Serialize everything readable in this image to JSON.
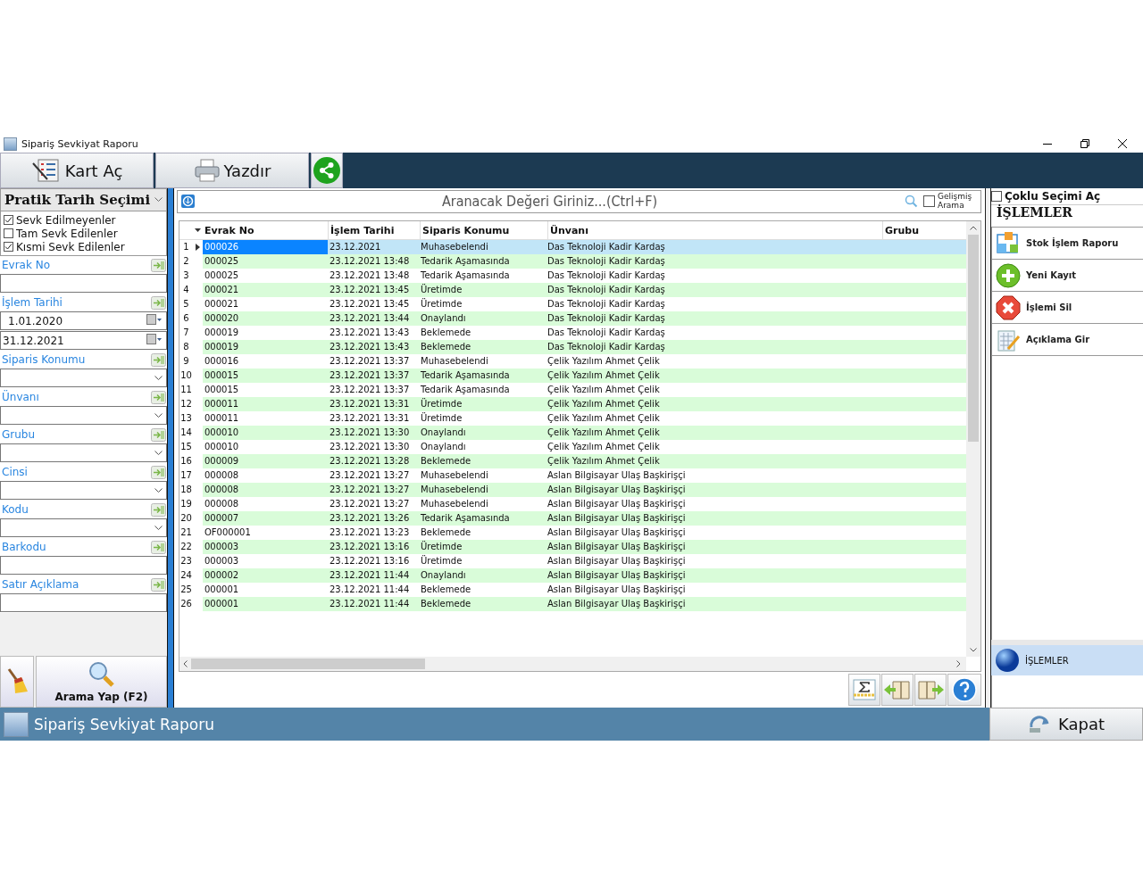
{
  "window": {
    "title": "Sipariş Sevkiyat Raporu"
  },
  "toolbar": [
    {
      "kind": "card",
      "label": "Kart Aç"
    },
    {
      "kind": "print",
      "label": "Yazdır"
    },
    {
      "kind": "share"
    }
  ],
  "filters": {
    "date_preset": "Pratik Tarih Seçimi",
    "options": [
      {
        "label": "Sevk Edilmeyenler",
        "checked": true
      },
      {
        "label": "Tam Sevk Edilenler",
        "checked": false
      },
      {
        "label": "Kısmi Sevk Edilenler",
        "checked": true
      }
    ],
    "fields": [
      {
        "label": "Evrak No",
        "kind": "text"
      },
      {
        "label": "İşlem Tarihi",
        "kind": "dates",
        "values": [
          "1.01.2020",
          "31.12.2021"
        ]
      },
      {
        "label": "Siparis Konumu",
        "kind": "combo"
      },
      {
        "label": "Ünvanı",
        "kind": "combo"
      },
      {
        "label": "Grubu",
        "kind": "combo"
      },
      {
        "label": "Cinsi",
        "kind": "combo"
      },
      {
        "label": "Kodu",
        "kind": "combo"
      },
      {
        "label": "Barkodu",
        "kind": "text"
      },
      {
        "label": "Satır Açıklama",
        "kind": "text"
      }
    ],
    "search_button": "Arama Yap (F2)"
  },
  "search": {
    "placeholder": "Aranacak Değeri Giriniz...(Ctrl+F)",
    "advanced": {
      "label": "Gelişmiş Arama",
      "checked": false
    }
  },
  "table": {
    "columns": [
      "Evrak No",
      "İşlem Tarihi",
      "Siparis Konumu",
      "Ünvanı",
      "Grubu"
    ],
    "rows": [
      {
        "n": "1",
        "cells": [
          "000026",
          "23.12.2021",
          "Muhasebelendi",
          "Das Teknoloji Kadir Kardaş"
        ],
        "selected": true
      },
      {
        "n": "2",
        "cells": [
          "000025",
          "23.12.2021 13:48",
          "Tedarik Aşamasında",
          "Das Teknoloji Kadir Kardaş"
        ],
        "selected": false
      },
      {
        "n": "3",
        "cells": [
          "000025",
          "23.12.2021 13:48",
          "Tedarik Aşamasında",
          "Das Teknoloji Kadir Kardaş"
        ],
        "selected": false
      },
      {
        "n": "4",
        "cells": [
          "000021",
          "23.12.2021 13:45",
          "Üretimde",
          "Das Teknoloji Kadir Kardaş"
        ],
        "selected": false
      },
      {
        "n": "5",
        "cells": [
          "000021",
          "23.12.2021 13:45",
          "Üretimde",
          "Das Teknoloji Kadir Kardaş"
        ],
        "selected": false
      },
      {
        "n": "6",
        "cells": [
          "000020",
          "23.12.2021 13:44",
          "Onaylandı",
          "Das Teknoloji Kadir Kardaş"
        ],
        "selected": false
      },
      {
        "n": "7",
        "cells": [
          "000019",
          "23.12.2021 13:43",
          "Beklemede",
          "Das Teknoloji Kadir Kardaş"
        ],
        "selected": false
      },
      {
        "n": "8",
        "cells": [
          "000019",
          "23.12.2021 13:43",
          "Beklemede",
          "Das Teknoloji Kadir Kardaş"
        ],
        "selected": false
      },
      {
        "n": "9",
        "cells": [
          "000016",
          "23.12.2021 13:37",
          "Muhasebelendi",
          "Çelik Yazılım Ahmet Çelik"
        ],
        "selected": false
      },
      {
        "n": "10",
        "cells": [
          "000015",
          "23.12.2021 13:37",
          "Tedarik Aşamasında",
          "Çelik Yazılım Ahmet Çelik"
        ],
        "selected": false
      },
      {
        "n": "11",
        "cells": [
          "000015",
          "23.12.2021 13:37",
          "Tedarik Aşamasında",
          "Çelik Yazılım Ahmet Çelik"
        ],
        "selected": false
      },
      {
        "n": "12",
        "cells": [
          "000011",
          "23.12.2021 13:31",
          "Üretimde",
          "Çelik Yazılım Ahmet Çelik"
        ],
        "selected": false
      },
      {
        "n": "13",
        "cells": [
          "000011",
          "23.12.2021 13:31",
          "Üretimde",
          "Çelik Yazılım Ahmet Çelik"
        ],
        "selected": false
      },
      {
        "n": "14",
        "cells": [
          "000010",
          "23.12.2021 13:30",
          "Onaylandı",
          "Çelik Yazılım Ahmet Çelik"
        ],
        "selected": false
      },
      {
        "n": "15",
        "cells": [
          "000010",
          "23.12.2021 13:30",
          "Onaylandı",
          "Çelik Yazılım Ahmet Çelik"
        ],
        "selected": false
      },
      {
        "n": "16",
        "cells": [
          "000009",
          "23.12.2021 13:28",
          "Beklemede",
          "Çelik Yazılım Ahmet Çelik"
        ],
        "selected": false
      },
      {
        "n": "17",
        "cells": [
          "000008",
          "23.12.2021 13:27",
          "Muhasebelendi",
          "Aslan Bilgisayar Ulaş Başkirişçi"
        ],
        "selected": false
      },
      {
        "n": "18",
        "cells": [
          "000008",
          "23.12.2021 13:27",
          "Muhasebelendi",
          "Aslan Bilgisayar Ulaş Başkirişçi"
        ],
        "selected": false
      },
      {
        "n": "19",
        "cells": [
          "000008",
          "23.12.2021 13:27",
          "Muhasebelendi",
          "Aslan Bilgisayar Ulaş Başkirişçi"
        ],
        "selected": false
      },
      {
        "n": "20",
        "cells": [
          "000007",
          "23.12.2021 13:26",
          "Tedarik Aşamasında",
          "Aslan Bilgisayar Ulaş Başkirişçi"
        ],
        "selected": false
      },
      {
        "n": "21",
        "cells": [
          "OF000001",
          "23.12.2021 13:23",
          "Beklemede",
          "Aslan Bilgisayar Ulaş Başkirişçi"
        ],
        "selected": false
      },
      {
        "n": "22",
        "cells": [
          "000003",
          "23.12.2021 13:16",
          "Üretimde",
          "Aslan Bilgisayar Ulaş Başkirişçi"
        ],
        "selected": false
      },
      {
        "n": "23",
        "cells": [
          "000003",
          "23.12.2021 13:16",
          "Üretimde",
          "Aslan Bilgisayar Ulaş Başkirişçi"
        ],
        "selected": false
      },
      {
        "n": "24",
        "cells": [
          "000002",
          "23.12.2021 11:44",
          "Onaylandı",
          "Aslan Bilgisayar Ulaş Başkirişçi"
        ],
        "selected": false
      },
      {
        "n": "25",
        "cells": [
          "000001",
          "23.12.2021 11:44",
          "Beklemede",
          "Aslan Bilgisayar Ulaş Başkirişçi"
        ],
        "selected": false
      },
      {
        "n": "26",
        "cells": [
          "000001",
          "23.12.2021 11:44",
          "Beklemede",
          "Aslan Bilgisayar Ulaş Başkirişçi"
        ],
        "selected": false
      }
    ]
  },
  "bottom_tools": [
    {
      "kind": "sum"
    },
    {
      "kind": "prev"
    },
    {
      "kind": "next"
    },
    {
      "kind": "help"
    }
  ],
  "right_panel": {
    "multi_select": {
      "label": "Çoklu Seçimi Aç",
      "checked": false
    },
    "title": "İŞLEMLER",
    "actions": [
      {
        "kind": "report",
        "label": "Stok İşlem Raporu"
      },
      {
        "kind": "add",
        "label": "Yeni Kayıt"
      },
      {
        "kind": "delete",
        "label": "İşlemi Sil"
      },
      {
        "kind": "note",
        "label": "Açıklama Gir"
      }
    ],
    "section": "İŞLEMLER"
  },
  "status_bar": {
    "title": "Sipariş Sevkiyat Raporu",
    "close_button": "Kapat"
  }
}
